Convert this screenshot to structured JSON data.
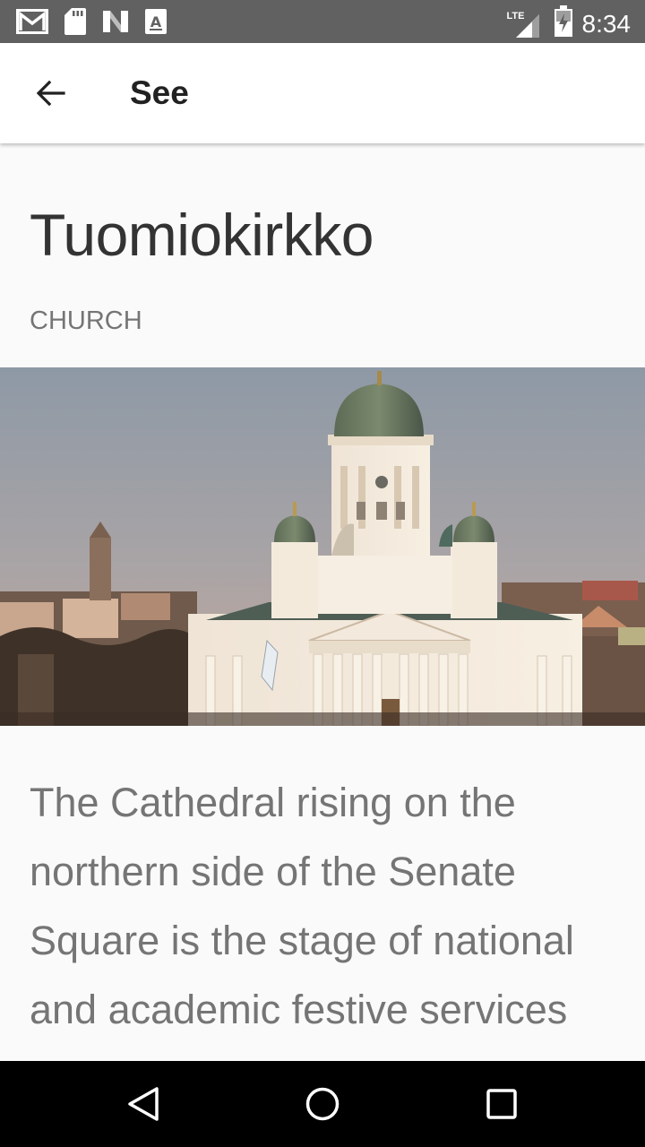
{
  "status_bar": {
    "time": "8:34",
    "network": "LTE",
    "icons": [
      "gmail-icon",
      "sd-card-icon",
      "n-notification-icon",
      "a-notification-icon",
      "signal-icon",
      "battery-icon"
    ]
  },
  "app_bar": {
    "title": "See",
    "back_icon": "arrow-back-icon"
  },
  "place": {
    "title": "Tuomiokirkko",
    "category": "CHURCH",
    "image": "helsinki-cathedral-photo",
    "description": "The Cathedral rising on the northern side of the Senate Square is the stage of national and academic festive services"
  },
  "nav_bar": {
    "buttons": [
      "back-triangle-icon",
      "home-circle-icon",
      "recents-square-icon"
    ]
  },
  "colors": {
    "status_bar": "#616161",
    "app_bar": "#ffffff",
    "background": "#fafafa",
    "title_text": "#333333",
    "secondary_text": "#757575",
    "nav_bar": "#000000"
  }
}
